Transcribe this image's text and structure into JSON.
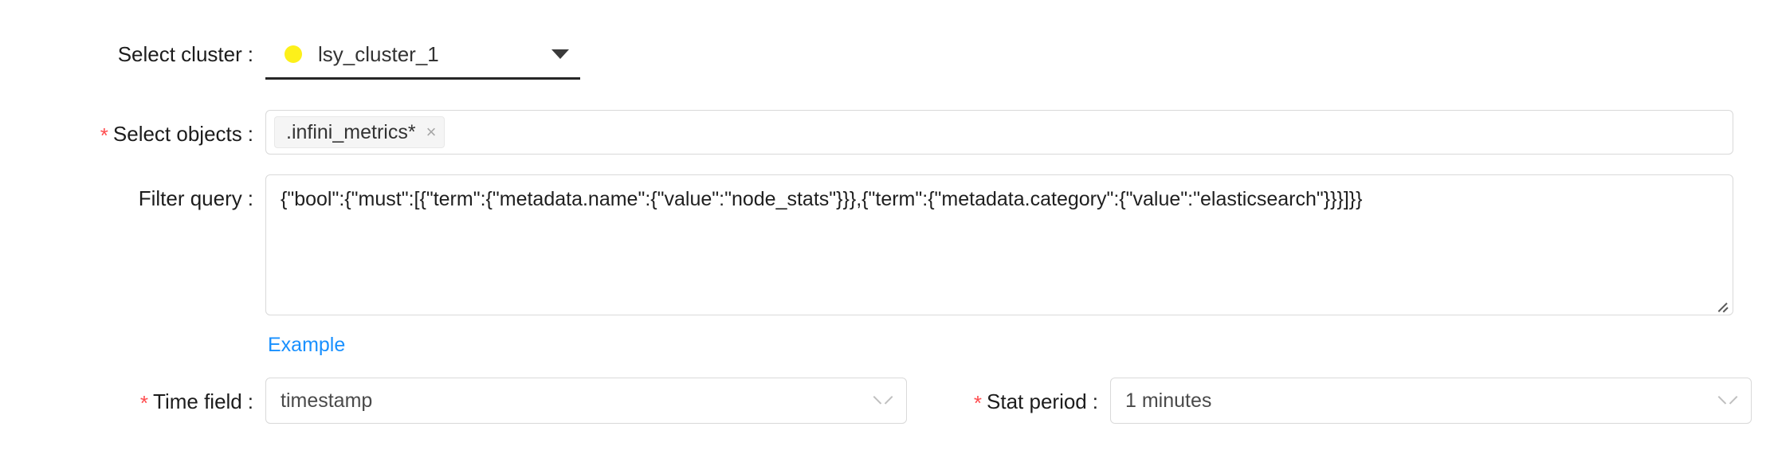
{
  "form": {
    "cluster": {
      "label": "Select cluster",
      "colon": ":",
      "required": false,
      "status_color": "#fdf01a",
      "value": "lsy_cluster_1",
      "caret_icon": "caret-down-icon"
    },
    "objects": {
      "label": "Select objects",
      "colon": ":",
      "required": true,
      "required_mark": "*",
      "tags": [
        {
          "text": ".infini_metrics*",
          "close_icon": "×"
        }
      ]
    },
    "filter_query": {
      "label": "Filter query",
      "colon": ":",
      "required": false,
      "value": "{\"bool\":{\"must\":[{\"term\":{\"metadata.name\":{\"value\":\"node_stats\"}}},{\"term\":{\"metadata.category\":{\"value\":\"elasticsearch\"}}}]}}",
      "placeholder": "",
      "example_link": "Example",
      "example_link_color": "#1890ff",
      "resize_handle_icon": "resize-grip-icon"
    },
    "time_field": {
      "label": "Time field",
      "colon": ":",
      "required": true,
      "required_mark": "*",
      "value": "timestamp",
      "chevron_icon": "chevron-down-icon"
    },
    "stat_period": {
      "label": "Stat period",
      "colon": ":",
      "required": true,
      "required_mark": "*",
      "value": "1 minutes",
      "chevron_icon": "chevron-down-icon"
    }
  },
  "colors": {
    "required_asterisk": "#ff4d4f",
    "link": "#1890ff",
    "border": "#d9d9d9",
    "tag_background": "#f5f5f5",
    "underline": "#262626",
    "cluster_status_dot": "#fdf01a"
  }
}
